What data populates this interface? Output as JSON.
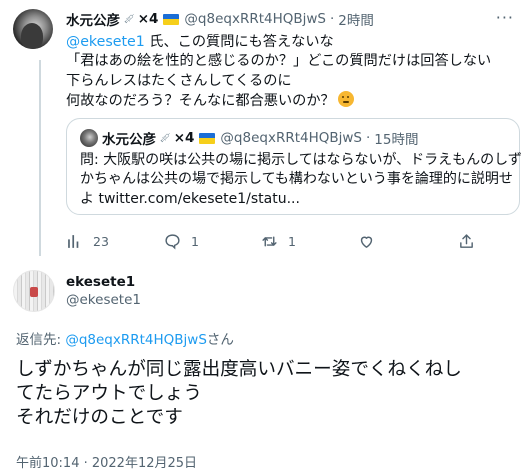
{
  "tweet1": {
    "display_name": "水元公彦",
    "syringe_icon": "syringe-icon",
    "badge_count": "×4",
    "flag_icon": "ukraine-flag-icon",
    "handle": "@q8eqxRRt4HQBjwS",
    "dot": "·",
    "time": "2時間",
    "more_icon": "more-icon",
    "text": {
      "mention": "@ekesete1",
      "line1_rest": " 氏、この質問にも答えないな",
      "line2": "「君はあの絵を性的と感じるのか？」どこの質問だけは回答しない",
      "line3": "下らんレスはたくさんしてくるのに",
      "line4": "何故なのだろう？そんなに都合悪いのか？",
      "emoji_icon": "thinking-face-icon"
    },
    "quote": {
      "display_name": "水元公彦",
      "badge_count": "×4",
      "handle": "@q8eqxRRt4HQBjwS",
      "dot": "·",
      "time": "15時間",
      "line1": "問: 大阪駅の咲は公共の場に掲示してはならないが、ドラえもんのしず",
      "line2": "かちゃんは公共の場で掲示しても構わないという事を論理的に説明せ",
      "line3": "よ twitter.com/ekesete1/statu..."
    },
    "actions": {
      "views": "23",
      "replies": "1",
      "retweets": "1",
      "likes": "",
      "share": ""
    }
  },
  "tweet2": {
    "display_name": "ekesete1",
    "handle": "@ekesete1",
    "replying_prefix": "返信先: ",
    "replying_handle": "@q8eqxRRt4HQBjwS",
    "replying_suffix": "さん",
    "line1": "しずかちゃんが同じ露出度高いバニー姿でくねくねし",
    "line2": "てたらアウトでしょう",
    "line3": "それだけのことです",
    "timestamp": "午前10:14 · 2022年12月25日"
  }
}
